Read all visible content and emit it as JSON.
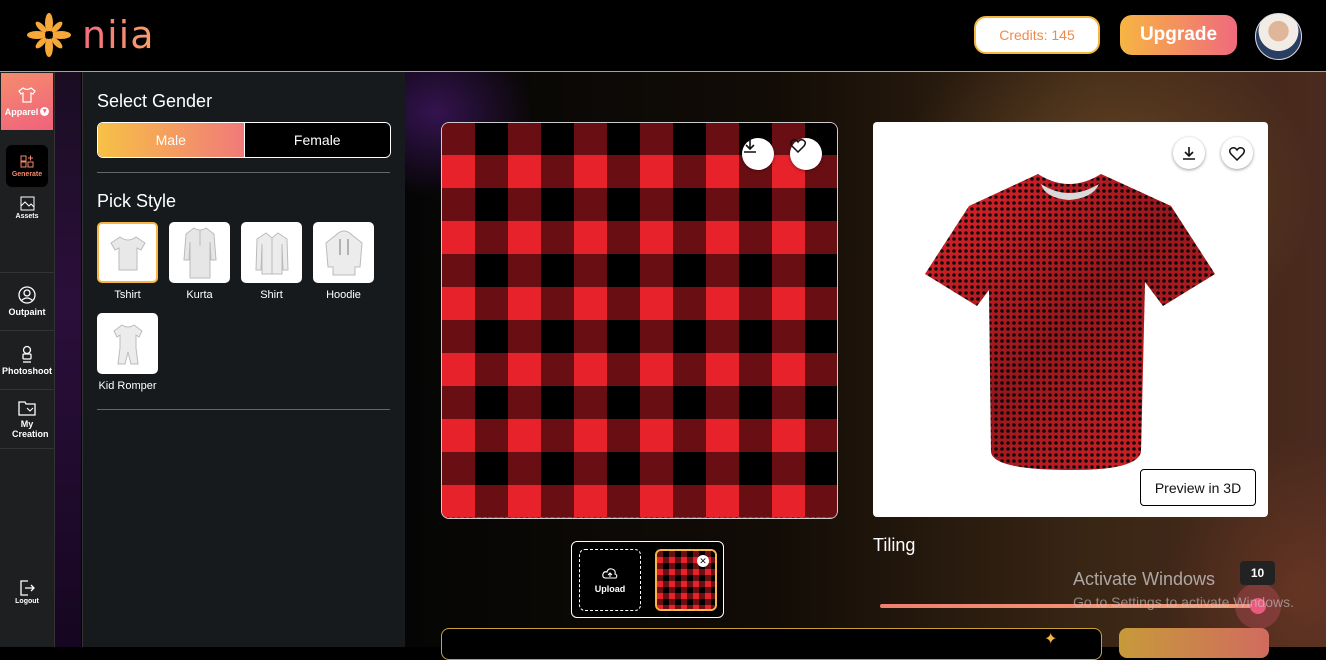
{
  "header": {
    "brand": "Niia",
    "credits_label": "Credits: 145",
    "upgrade_label": "Upgrade"
  },
  "rail": {
    "items": [
      {
        "label": "Apparel",
        "icon": "shirt-icon"
      },
      {
        "label": "Generate",
        "icon": "generate-icon"
      },
      {
        "label": "Assets",
        "icon": "assets-icon"
      },
      {
        "label": "Outpaint",
        "icon": "outpaint-icon"
      },
      {
        "label": "Photoshoot",
        "icon": "photoshoot-icon"
      },
      {
        "label": "My Creation",
        "icon": "folder-icon"
      },
      {
        "label": "Logout",
        "icon": "logout-icon"
      }
    ]
  },
  "panel": {
    "gender_title": "Select Gender",
    "gender_options": [
      "Male",
      "Female"
    ],
    "selected_gender": "Male",
    "style_title": "Pick Style",
    "styles": [
      "Tshirt",
      "Kurta",
      "Shirt",
      "Hoodie",
      "Kid Romper"
    ],
    "selected_style": "Tshirt"
  },
  "main": {
    "preview_3d_label": "Preview in 3D",
    "upload_label": "Upload",
    "tiling_label": "Tiling",
    "tiling_value": "10",
    "pattern_colors": {
      "red": "#e8222a",
      "black": "#000000"
    }
  },
  "os_watermark": {
    "line1": "Activate Windows",
    "line2": "Go to Settings to activate Windows."
  }
}
